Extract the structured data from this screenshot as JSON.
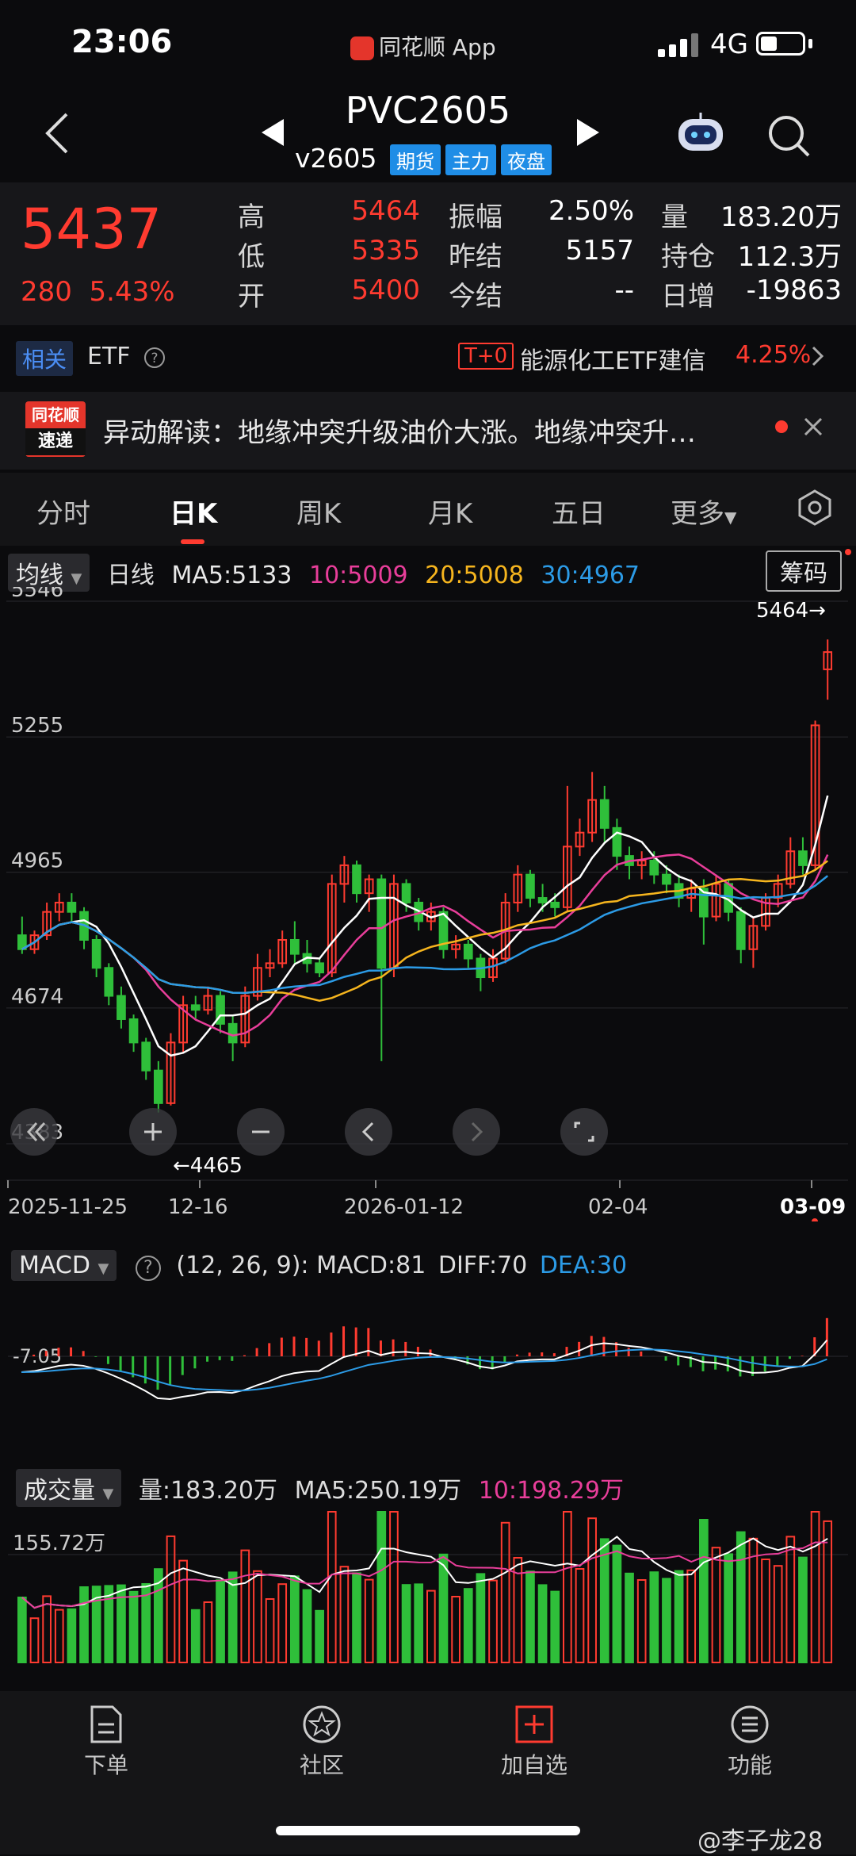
{
  "status_bar": {
    "time": "23:06",
    "app": "同花顺 App",
    "network": "4G"
  },
  "header": {
    "title": "PVC2605",
    "subtitle": "v2605",
    "tags": [
      "期货",
      "主力",
      "夜盘"
    ]
  },
  "quote": {
    "price": "5437",
    "change": "280",
    "change_pct": "5.43%",
    "fields": [
      {
        "label": "高",
        "value": "5464",
        "color": "#ff3b30"
      },
      {
        "label": "低",
        "value": "5335",
        "color": "#ff3b30"
      },
      {
        "label": "开",
        "value": "5400",
        "color": "#ff3b30"
      },
      {
        "label": "振幅",
        "value": "2.50%",
        "color": "#ffffff"
      },
      {
        "label": "昨结",
        "value": "5157",
        "color": "#ffffff"
      },
      {
        "label": "今结",
        "value": "--",
        "color": "#ffffff"
      },
      {
        "label": "量",
        "value": "183.20万",
        "color": "#ffffff"
      },
      {
        "label": "持仓",
        "value": "112.3万",
        "color": "#ffffff"
      },
      {
        "label": "日增",
        "value": "-19863",
        "color": "#ffffff"
      }
    ]
  },
  "etf_row": {
    "tag": "相关",
    "label": "ETF",
    "t0": "T+0",
    "fund": "能源化工ETF建信",
    "pct": "4.25%"
  },
  "news": {
    "logo_top": "同花顺",
    "logo_bottom": "速递",
    "text": "异动解读：地缘冲突升级油价大涨。地缘冲突升…"
  },
  "tabs": {
    "items": [
      "分时",
      "日K",
      "周K",
      "月K",
      "五日",
      "更多"
    ],
    "active": "日K"
  },
  "kline_legend": {
    "indicator": "均线",
    "period": "日线",
    "ma5": "MA5:5133",
    "ma10": "10:5009",
    "ma20": "20:5008",
    "ma30": "30:4967",
    "chips": "筹码"
  },
  "kline_axis": {
    "y_ticks": [
      "5546",
      "5255",
      "4965",
      "4674",
      "4383"
    ],
    "x_ticks": [
      "2025-11-25",
      "12-16",
      "2026-01-12",
      "02-04",
      "03-09"
    ],
    "high_label": "5464→",
    "low_label": "←4465"
  },
  "macd_legend": {
    "name": "MACD",
    "params": "(12, 26, 9):",
    "macd": "MACD:81",
    "diff": "DIFF:70",
    "dea": "DEA:30",
    "tick": "-7.05"
  },
  "volume_legend": {
    "name": "成交量",
    "vol": "量:183.20万",
    "ma5": "MA5:250.19万",
    "ma10": "10:198.29万",
    "tick": "155.72万"
  },
  "bottom_nav": {
    "items": [
      "下单",
      "社区",
      "加自选",
      "功能"
    ]
  },
  "watermark": "@李子龙28",
  "colors": {
    "up": "#ff3b30",
    "down": "#2fbf3a",
    "ma5": "#ffffff",
    "ma10": "#e83e9a",
    "ma20": "#f6b51e",
    "ma30": "#2c9be6"
  },
  "chart_data": {
    "type": "candlestick",
    "title": "PVC2605 日K",
    "ylim": [
      4383,
      5546
    ],
    "candles": [
      {
        "o": 4830,
        "h": 4870,
        "l": 4790,
        "c": 4800
      },
      {
        "o": 4800,
        "h": 4840,
        "l": 4790,
        "c": 4830
      },
      {
        "o": 4830,
        "h": 4900,
        "l": 4820,
        "c": 4880
      },
      {
        "o": 4880,
        "h": 4920,
        "l": 4860,
        "c": 4900
      },
      {
        "o": 4900,
        "h": 4920,
        "l": 4860,
        "c": 4880
      },
      {
        "o": 4880,
        "h": 4890,
        "l": 4800,
        "c": 4820
      },
      {
        "o": 4820,
        "h": 4830,
        "l": 4740,
        "c": 4760
      },
      {
        "o": 4760,
        "h": 4770,
        "l": 4680,
        "c": 4700
      },
      {
        "o": 4700,
        "h": 4720,
        "l": 4630,
        "c": 4650
      },
      {
        "o": 4650,
        "h": 4660,
        "l": 4580,
        "c": 4600
      },
      {
        "o": 4600,
        "h": 4610,
        "l": 4520,
        "c": 4540
      },
      {
        "o": 4540,
        "h": 4560,
        "l": 4450,
        "c": 4470
      },
      {
        "o": 4470,
        "h": 4620,
        "l": 4465,
        "c": 4600
      },
      {
        "o": 4600,
        "h": 4700,
        "l": 4580,
        "c": 4680
      },
      {
        "o": 4680,
        "h": 4700,
        "l": 4650,
        "c": 4670
      },
      {
        "o": 4670,
        "h": 4720,
        "l": 4660,
        "c": 4700
      },
      {
        "o": 4700,
        "h": 4710,
        "l": 4620,
        "c": 4640
      },
      {
        "o": 4640,
        "h": 4660,
        "l": 4560,
        "c": 4600
      },
      {
        "o": 4600,
        "h": 4720,
        "l": 4590,
        "c": 4700
      },
      {
        "o": 4700,
        "h": 4790,
        "l": 4690,
        "c": 4760
      },
      {
        "o": 4760,
        "h": 4800,
        "l": 4740,
        "c": 4770
      },
      {
        "o": 4770,
        "h": 4840,
        "l": 4760,
        "c": 4820
      },
      {
        "o": 4820,
        "h": 4860,
        "l": 4770,
        "c": 4790
      },
      {
        "o": 4790,
        "h": 4820,
        "l": 4750,
        "c": 4770
      },
      {
        "o": 4770,
        "h": 4780,
        "l": 4740,
        "c": 4750
      },
      {
        "o": 4750,
        "h": 4960,
        "l": 4740,
        "c": 4940
      },
      {
        "o": 4940,
        "h": 5000,
        "l": 4900,
        "c": 4980
      },
      {
        "o": 4980,
        "h": 4990,
        "l": 4900,
        "c": 4920
      },
      {
        "o": 4920,
        "h": 4960,
        "l": 4880,
        "c": 4950
      },
      {
        "o": 4950,
        "h": 4960,
        "l": 4560,
        "c": 4760
      },
      {
        "o": 4760,
        "h": 4960,
        "l": 4740,
        "c": 4940
      },
      {
        "o": 4940,
        "h": 4950,
        "l": 4880,
        "c": 4900
      },
      {
        "o": 4900,
        "h": 4910,
        "l": 4840,
        "c": 4860
      },
      {
        "o": 4860,
        "h": 4900,
        "l": 4840,
        "c": 4880
      },
      {
        "o": 4880,
        "h": 4890,
        "l": 4780,
        "c": 4800
      },
      {
        "o": 4800,
        "h": 4830,
        "l": 4780,
        "c": 4810
      },
      {
        "o": 4810,
        "h": 4820,
        "l": 4760,
        "c": 4780
      },
      {
        "o": 4780,
        "h": 4790,
        "l": 4710,
        "c": 4740
      },
      {
        "o": 4740,
        "h": 4800,
        "l": 4730,
        "c": 4780
      },
      {
        "o": 4780,
        "h": 4920,
        "l": 4770,
        "c": 4900
      },
      {
        "o": 4900,
        "h": 4980,
        "l": 4880,
        "c": 4960
      },
      {
        "o": 4960,
        "h": 4970,
        "l": 4890,
        "c": 4910
      },
      {
        "o": 4910,
        "h": 4940,
        "l": 4880,
        "c": 4900
      },
      {
        "o": 4900,
        "h": 4920,
        "l": 4870,
        "c": 4890
      },
      {
        "o": 4890,
        "h": 5150,
        "l": 4880,
        "c": 5020
      },
      {
        "o": 5020,
        "h": 5080,
        "l": 5000,
        "c": 5050
      },
      {
        "o": 5050,
        "h": 5180,
        "l": 5030,
        "c": 5120
      },
      {
        "o": 5120,
        "h": 5150,
        "l": 5030,
        "c": 5060
      },
      {
        "o": 5060,
        "h": 5080,
        "l": 4970,
        "c": 5000
      },
      {
        "o": 5000,
        "h": 5020,
        "l": 4950,
        "c": 4980
      },
      {
        "o": 4980,
        "h": 5010,
        "l": 4950,
        "c": 4990
      },
      {
        "o": 4990,
        "h": 5010,
        "l": 4940,
        "c": 4960
      },
      {
        "o": 4960,
        "h": 4980,
        "l": 4920,
        "c": 4940
      },
      {
        "o": 4940,
        "h": 4960,
        "l": 4890,
        "c": 4910
      },
      {
        "o": 4910,
        "h": 4950,
        "l": 4880,
        "c": 4930
      },
      {
        "o": 4930,
        "h": 4950,
        "l": 4810,
        "c": 4870
      },
      {
        "o": 4870,
        "h": 4960,
        "l": 4860,
        "c": 4940
      },
      {
        "o": 4940,
        "h": 4950,
        "l": 4860,
        "c": 4880
      },
      {
        "o": 4880,
        "h": 4890,
        "l": 4770,
        "c": 4800
      },
      {
        "o": 4800,
        "h": 4870,
        "l": 4760,
        "c": 4850
      },
      {
        "o": 4850,
        "h": 4920,
        "l": 4840,
        "c": 4910
      },
      {
        "o": 4910,
        "h": 4960,
        "l": 4890,
        "c": 4940
      },
      {
        "o": 4940,
        "h": 5040,
        "l": 4930,
        "c": 5010
      },
      {
        "o": 5010,
        "h": 5040,
        "l": 4960,
        "c": 4980
      },
      {
        "o": 4980,
        "h": 5290,
        "l": 4970,
        "c": 5280
      },
      {
        "o": 5400,
        "h": 5464,
        "l": 5335,
        "c": 5437
      }
    ]
  }
}
